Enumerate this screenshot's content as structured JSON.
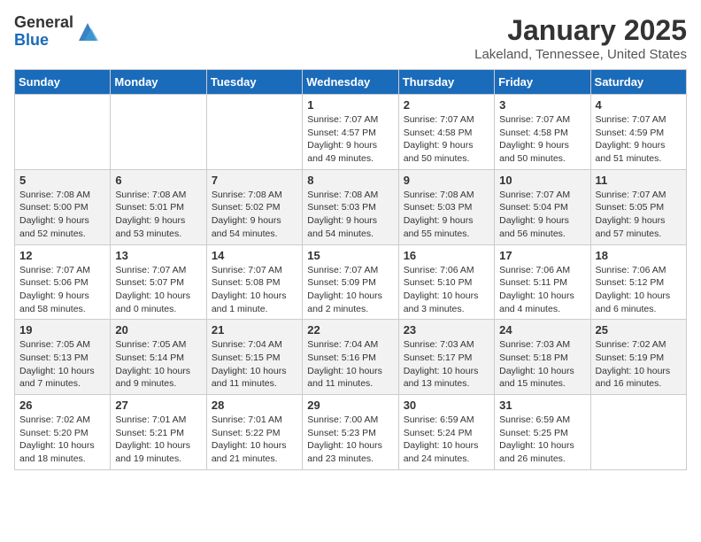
{
  "header": {
    "logo_line1": "General",
    "logo_line2": "Blue",
    "month": "January 2025",
    "location": "Lakeland, Tennessee, United States"
  },
  "weekdays": [
    "Sunday",
    "Monday",
    "Tuesday",
    "Wednesday",
    "Thursday",
    "Friday",
    "Saturday"
  ],
  "weeks": [
    [
      {
        "day": "",
        "info": ""
      },
      {
        "day": "",
        "info": ""
      },
      {
        "day": "",
        "info": ""
      },
      {
        "day": "1",
        "info": "Sunrise: 7:07 AM\nSunset: 4:57 PM\nDaylight: 9 hours\nand 49 minutes."
      },
      {
        "day": "2",
        "info": "Sunrise: 7:07 AM\nSunset: 4:58 PM\nDaylight: 9 hours\nand 50 minutes."
      },
      {
        "day": "3",
        "info": "Sunrise: 7:07 AM\nSunset: 4:58 PM\nDaylight: 9 hours\nand 50 minutes."
      },
      {
        "day": "4",
        "info": "Sunrise: 7:07 AM\nSunset: 4:59 PM\nDaylight: 9 hours\nand 51 minutes."
      }
    ],
    [
      {
        "day": "5",
        "info": "Sunrise: 7:08 AM\nSunset: 5:00 PM\nDaylight: 9 hours\nand 52 minutes."
      },
      {
        "day": "6",
        "info": "Sunrise: 7:08 AM\nSunset: 5:01 PM\nDaylight: 9 hours\nand 53 minutes."
      },
      {
        "day": "7",
        "info": "Sunrise: 7:08 AM\nSunset: 5:02 PM\nDaylight: 9 hours\nand 54 minutes."
      },
      {
        "day": "8",
        "info": "Sunrise: 7:08 AM\nSunset: 5:03 PM\nDaylight: 9 hours\nand 54 minutes."
      },
      {
        "day": "9",
        "info": "Sunrise: 7:08 AM\nSunset: 5:03 PM\nDaylight: 9 hours\nand 55 minutes."
      },
      {
        "day": "10",
        "info": "Sunrise: 7:07 AM\nSunset: 5:04 PM\nDaylight: 9 hours\nand 56 minutes."
      },
      {
        "day": "11",
        "info": "Sunrise: 7:07 AM\nSunset: 5:05 PM\nDaylight: 9 hours\nand 57 minutes."
      }
    ],
    [
      {
        "day": "12",
        "info": "Sunrise: 7:07 AM\nSunset: 5:06 PM\nDaylight: 9 hours\nand 58 minutes."
      },
      {
        "day": "13",
        "info": "Sunrise: 7:07 AM\nSunset: 5:07 PM\nDaylight: 10 hours\nand 0 minutes."
      },
      {
        "day": "14",
        "info": "Sunrise: 7:07 AM\nSunset: 5:08 PM\nDaylight: 10 hours\nand 1 minute."
      },
      {
        "day": "15",
        "info": "Sunrise: 7:07 AM\nSunset: 5:09 PM\nDaylight: 10 hours\nand 2 minutes."
      },
      {
        "day": "16",
        "info": "Sunrise: 7:06 AM\nSunset: 5:10 PM\nDaylight: 10 hours\nand 3 minutes."
      },
      {
        "day": "17",
        "info": "Sunrise: 7:06 AM\nSunset: 5:11 PM\nDaylight: 10 hours\nand 4 minutes."
      },
      {
        "day": "18",
        "info": "Sunrise: 7:06 AM\nSunset: 5:12 PM\nDaylight: 10 hours\nand 6 minutes."
      }
    ],
    [
      {
        "day": "19",
        "info": "Sunrise: 7:05 AM\nSunset: 5:13 PM\nDaylight: 10 hours\nand 7 minutes."
      },
      {
        "day": "20",
        "info": "Sunrise: 7:05 AM\nSunset: 5:14 PM\nDaylight: 10 hours\nand 9 minutes."
      },
      {
        "day": "21",
        "info": "Sunrise: 7:04 AM\nSunset: 5:15 PM\nDaylight: 10 hours\nand 11 minutes."
      },
      {
        "day": "22",
        "info": "Sunrise: 7:04 AM\nSunset: 5:16 PM\nDaylight: 10 hours\nand 11 minutes."
      },
      {
        "day": "23",
        "info": "Sunrise: 7:03 AM\nSunset: 5:17 PM\nDaylight: 10 hours\nand 13 minutes."
      },
      {
        "day": "24",
        "info": "Sunrise: 7:03 AM\nSunset: 5:18 PM\nDaylight: 10 hours\nand 15 minutes."
      },
      {
        "day": "25",
        "info": "Sunrise: 7:02 AM\nSunset: 5:19 PM\nDaylight: 10 hours\nand 16 minutes."
      }
    ],
    [
      {
        "day": "26",
        "info": "Sunrise: 7:02 AM\nSunset: 5:20 PM\nDaylight: 10 hours\nand 18 minutes."
      },
      {
        "day": "27",
        "info": "Sunrise: 7:01 AM\nSunset: 5:21 PM\nDaylight: 10 hours\nand 19 minutes."
      },
      {
        "day": "28",
        "info": "Sunrise: 7:01 AM\nSunset: 5:22 PM\nDaylight: 10 hours\nand 21 minutes."
      },
      {
        "day": "29",
        "info": "Sunrise: 7:00 AM\nSunset: 5:23 PM\nDaylight: 10 hours\nand 23 minutes."
      },
      {
        "day": "30",
        "info": "Sunrise: 6:59 AM\nSunset: 5:24 PM\nDaylight: 10 hours\nand 24 minutes."
      },
      {
        "day": "31",
        "info": "Sunrise: 6:59 AM\nSunset: 5:25 PM\nDaylight: 10 hours\nand 26 minutes."
      },
      {
        "day": "",
        "info": ""
      }
    ]
  ]
}
